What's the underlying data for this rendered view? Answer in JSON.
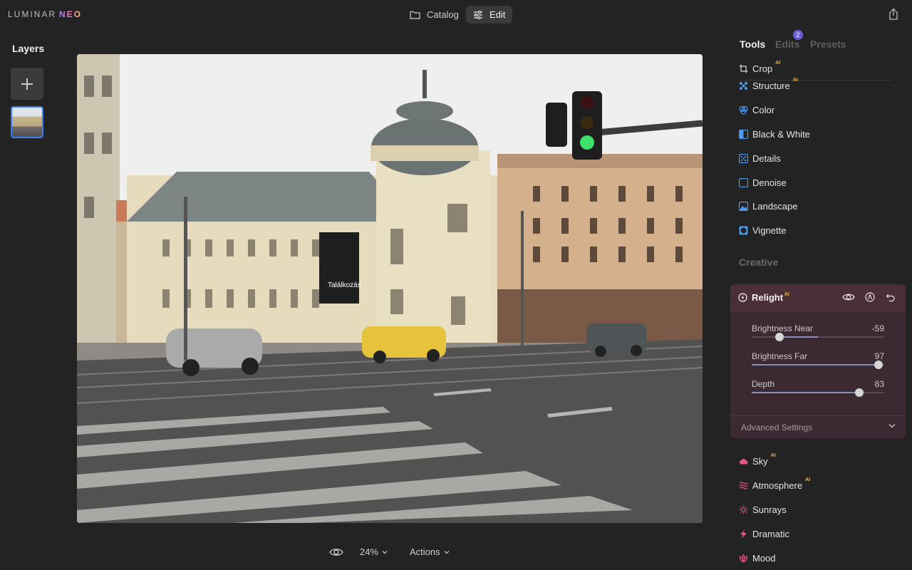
{
  "app": {
    "logo_main": "LUMINAR",
    "logo_accent": "NEO"
  },
  "topbar": {
    "catalog_label": "Catalog",
    "edit_label": "Edit",
    "share_icon": "share-icon"
  },
  "layers": {
    "title": "Layers",
    "add_icon": "plus-icon"
  },
  "bottombar": {
    "zoom_label": "24%",
    "actions_label": "Actions"
  },
  "panel": {
    "tabs": [
      {
        "label": "Tools",
        "active": true
      },
      {
        "label": "Edits",
        "badge": "2"
      },
      {
        "label": "Presets"
      }
    ],
    "essentials": [
      {
        "label": "Crop",
        "ai": "AI",
        "icon": "crop-icon"
      },
      {
        "label": "Structure",
        "ai": "AI",
        "icon": "structure-icon"
      },
      {
        "label": "Color",
        "icon": "color-icon"
      },
      {
        "label": "Black & White",
        "icon": "black-white-icon"
      },
      {
        "label": "Details",
        "icon": "details-icon"
      },
      {
        "label": "Denoise",
        "icon": "denoise-icon"
      },
      {
        "label": "Landscape",
        "icon": "landscape-icon"
      },
      {
        "label": "Vignette",
        "icon": "vignette-icon"
      }
    ],
    "creative_title": "Creative",
    "relight": {
      "title": "Relight",
      "ai": "AI",
      "sliders": [
        {
          "label": "Brightness Near",
          "value": "-59",
          "fraction": 0.21
        },
        {
          "label": "Brightness Far",
          "value": "97",
          "fraction": 0.955
        },
        {
          "label": "Depth",
          "value": "83",
          "fraction": 0.81
        }
      ],
      "advanced_label": "Advanced Settings"
    },
    "creative": [
      {
        "label": "Sky",
        "ai": "AI",
        "icon": "sky-icon"
      },
      {
        "label": "Atmosphere",
        "ai": "AI",
        "icon": "atmosphere-icon"
      },
      {
        "label": "Sunrays",
        "icon": "sunrays-icon"
      },
      {
        "label": "Dramatic",
        "icon": "dramatic-icon"
      },
      {
        "label": "Mood",
        "icon": "mood-icon"
      }
    ]
  },
  "photo": {
    "poster_text": "Találkozás"
  },
  "colors": {
    "accent_blue": "#3d7bf2",
    "ai_gold": "#f2b544",
    "relight_bg": "#3b2a31",
    "creative_pink": "#e0568f"
  }
}
